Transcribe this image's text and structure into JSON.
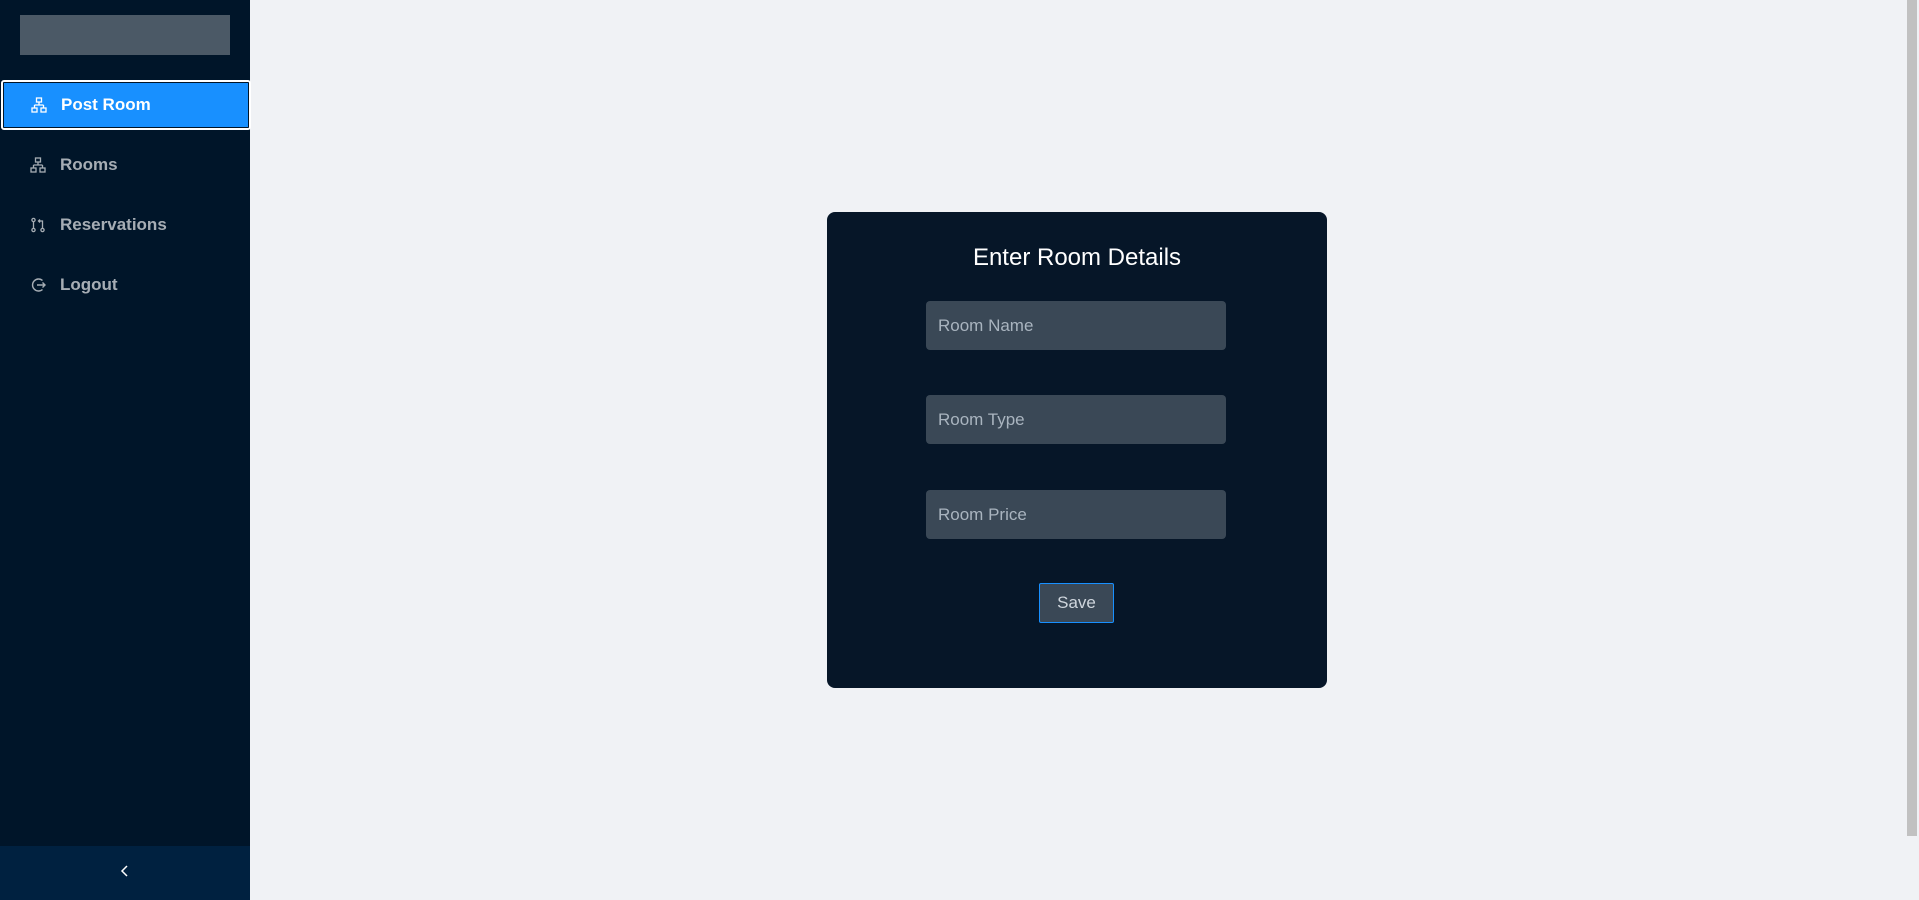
{
  "sidebar": {
    "items": [
      {
        "label": "Post Room",
        "icon": "cluster-icon",
        "active": true
      },
      {
        "label": "Rooms",
        "icon": "cluster-icon",
        "active": false
      },
      {
        "label": "Reservations",
        "icon": "pull-request-icon",
        "active": false
      },
      {
        "label": "Logout",
        "icon": "logout-icon",
        "active": false
      }
    ],
    "collapse_icon": "chevron-left-icon"
  },
  "form": {
    "title": "Enter Room Details",
    "room_name_placeholder": "Room Name",
    "room_type_placeholder": "Room Type",
    "room_price_placeholder": "Room Price",
    "save_label": "Save"
  },
  "colors": {
    "sidebar_bg": "#001529",
    "active_item": "#1890ff",
    "card_bg": "#061628",
    "page_bg": "#f0f2f5"
  }
}
